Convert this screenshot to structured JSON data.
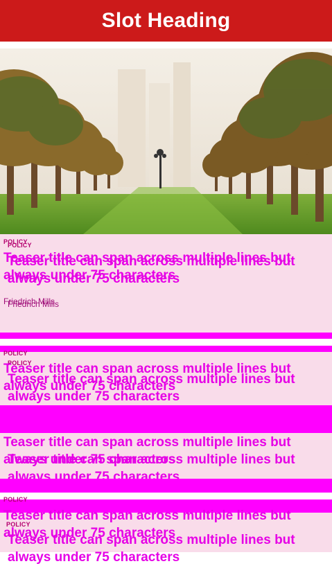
{
  "header": {
    "title": "Slot Heading"
  },
  "hero": {
    "alt_icon": "palm-tree-avenue-image"
  },
  "cards": [
    {
      "label": "POLICY",
      "title": "Teaser title can span across multiple lines but always under 75 characters",
      "author": "Friedrich Mills"
    },
    {
      "label": "POLICY",
      "title": "Teaser title can span across multiple lines but always under 75 characters"
    },
    {
      "label": "POLICY",
      "title": "Teaser title can span across multiple lines but always under 75 characters"
    },
    {
      "label": "POLICY",
      "title": "Teaser title can span across multiple lines but always under 75 characters"
    }
  ],
  "colors": {
    "header_bg": "#cc1a1a",
    "card_bg": "#f9dcea",
    "accent": "#ff00ff",
    "title": "#e600e6"
  }
}
